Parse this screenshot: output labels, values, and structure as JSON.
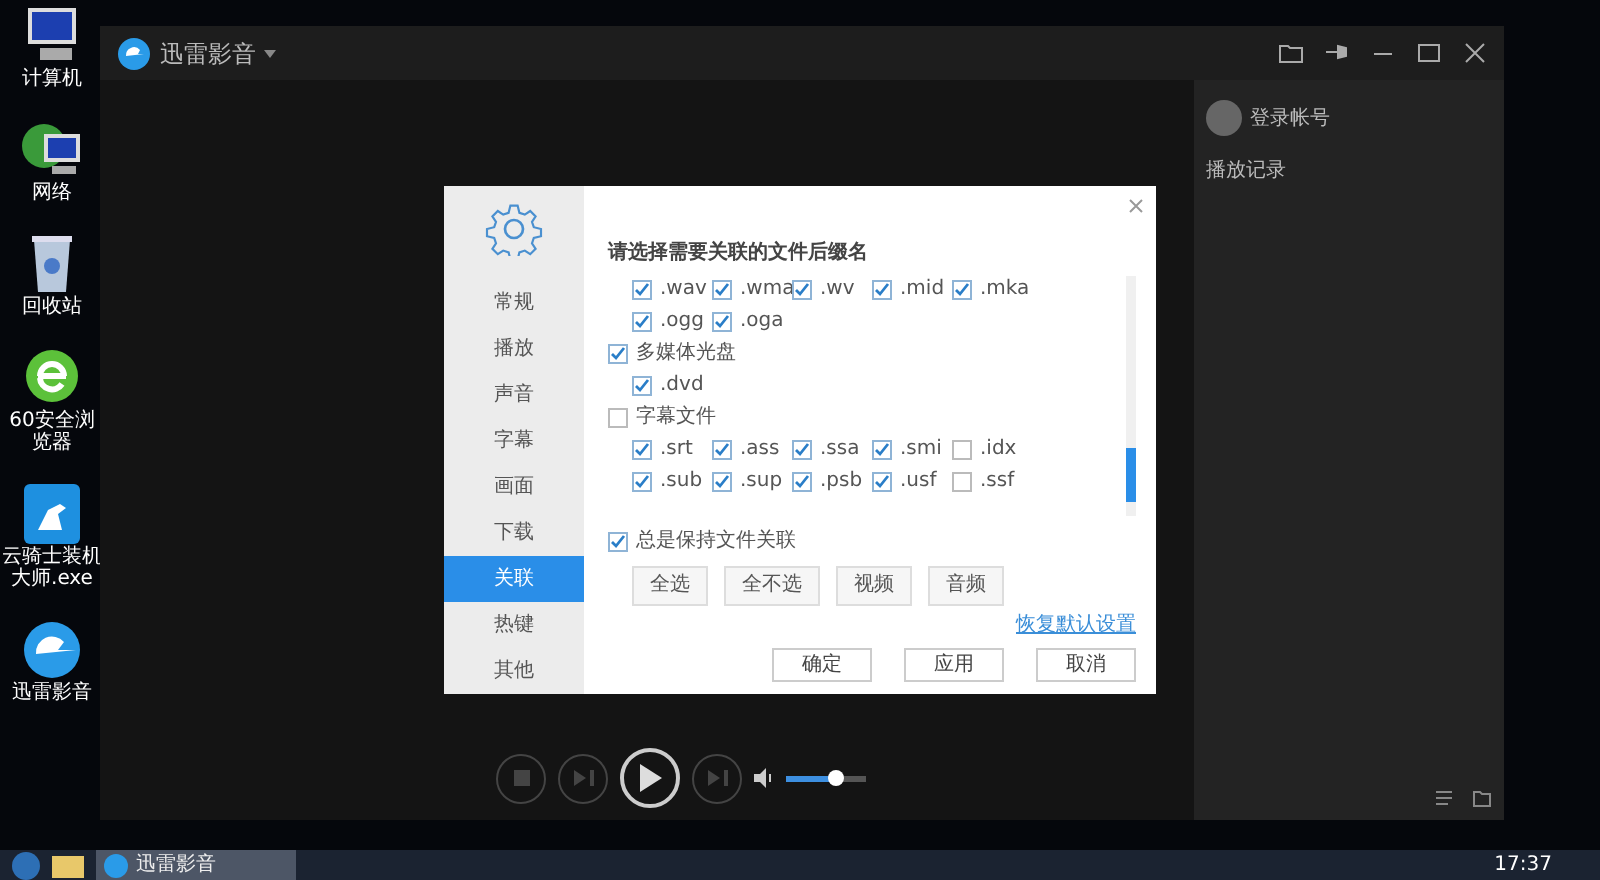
{
  "desktop_icons": [
    {
      "label": "计算机",
      "kind": "computer"
    },
    {
      "label": "网络",
      "kind": "network"
    },
    {
      "label": "回收站",
      "kind": "recycle"
    },
    {
      "label": "60安全浏览器",
      "kind": "browser"
    },
    {
      "label": "云骑士装机大师.exe",
      "kind": "knight"
    },
    {
      "label": "迅雷影音",
      "kind": "player"
    }
  ],
  "player": {
    "title": "迅雷影音",
    "account": "登录帐号",
    "history": "播放记录",
    "volume": {
      "level": 0.62
    }
  },
  "dialog": {
    "nav": [
      {
        "label": "常规",
        "selected": false
      },
      {
        "label": "播放",
        "selected": false
      },
      {
        "label": "声音",
        "selected": false
      },
      {
        "label": "字幕",
        "selected": false
      },
      {
        "label": "画面",
        "selected": false
      },
      {
        "label": "下载",
        "selected": false
      },
      {
        "label": "关联",
        "selected": true
      },
      {
        "label": "热键",
        "selected": false
      },
      {
        "label": "其他",
        "selected": false
      }
    ],
    "heading": "请选择需要关联的文件后缀名",
    "groups": [
      {
        "items": [
          {
            "ext": ".wav",
            "checked": true
          },
          {
            "ext": ".wma",
            "checked": true
          },
          {
            "ext": ".wv",
            "checked": true
          },
          {
            "ext": ".mid",
            "checked": true
          },
          {
            "ext": ".mka",
            "checked": true
          },
          {
            "ext": ".ogg",
            "checked": true
          },
          {
            "ext": ".oga",
            "checked": true
          }
        ]
      },
      {
        "label": "多媒体光盘",
        "checked": true,
        "items": [
          {
            "ext": ".dvd",
            "checked": true
          }
        ]
      },
      {
        "label": "字幕文件",
        "checked": false,
        "items": [
          {
            "ext": ".srt",
            "checked": true
          },
          {
            "ext": ".ass",
            "checked": true
          },
          {
            "ext": ".ssa",
            "checked": true
          },
          {
            "ext": ".smi",
            "checked": true
          },
          {
            "ext": ".idx",
            "checked": false
          },
          {
            "ext": ".sub",
            "checked": true
          },
          {
            "ext": ".sup",
            "checked": true
          },
          {
            "ext": ".psb",
            "checked": true
          },
          {
            "ext": ".usf",
            "checked": true
          },
          {
            "ext": ".ssf",
            "checked": false
          }
        ]
      }
    ],
    "always_keep": {
      "label": "总是保持文件关联",
      "checked": true
    },
    "quick_buttons": [
      "全选",
      "全不选",
      "视频",
      "音频"
    ],
    "restore_link": "恢复默认设置",
    "buttons": [
      "确定",
      "应用",
      "取消"
    ]
  },
  "taskbar": {
    "app": "迅雷影音",
    "clock": "17:37"
  }
}
